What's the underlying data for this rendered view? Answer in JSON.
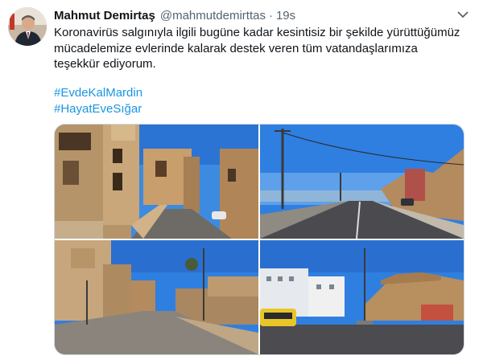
{
  "tweet": {
    "author_name": "Mahmut Demirtaş",
    "author_handle": "@mahmutdemirttas",
    "separator": "·",
    "time": "19s",
    "text": "Koronavirüs salgınıyla ilgili bugüne kadar kesintisiz bir şekilde yürüttüğümüz mücadelemize evlerinde kalarak destek veren tüm vatandaşlarımıza teşekkür ediyorum.",
    "hashtags": [
      "#EvdeKalMardin",
      "#HayatEveSığar"
    ]
  },
  "icons": {
    "more": "chevron-down-icon"
  },
  "colors": {
    "link": "#1b95e0",
    "text": "#0f1419",
    "secondary": "#536471"
  }
}
